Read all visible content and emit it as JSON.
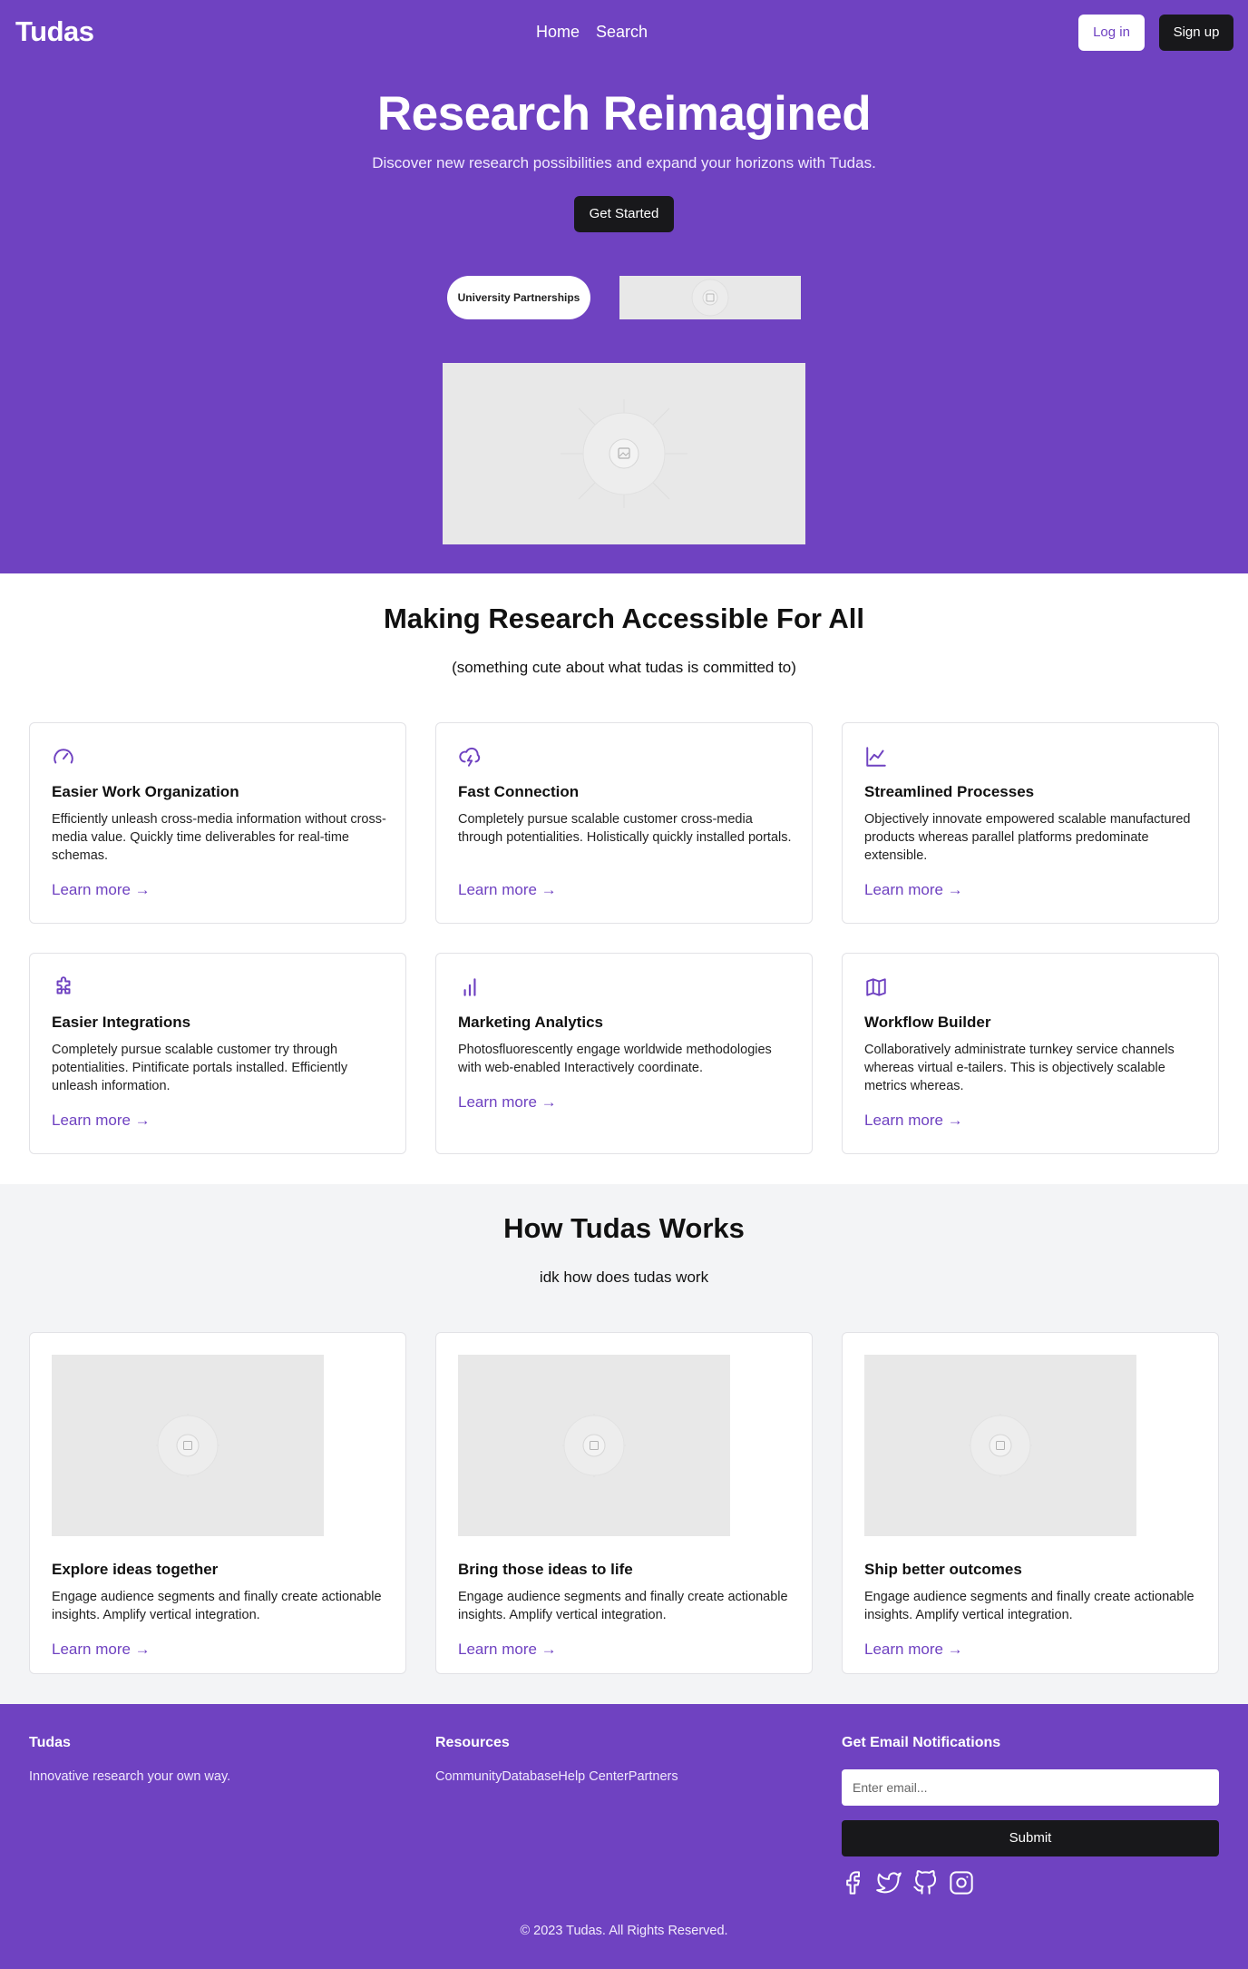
{
  "nav": {
    "brand": "Tudas",
    "links": [
      "Home",
      "Search"
    ],
    "login_label": "Log in",
    "signup_label": "Sign up"
  },
  "hero": {
    "title": "Research Reimagined",
    "subtitle": "Discover new research possibilities and expand your horizons with Tudas.",
    "cta_label": "Get Started",
    "pill_label": "University Partnerships"
  },
  "features": {
    "title": "Making Research Accessible For All",
    "subtitle": "(something cute about what tudas is committed to)",
    "items": [
      {
        "icon": "gauge-icon",
        "title": "Easier Work Organization",
        "text": "Efficiently unleash cross-media information without cross-media value. Quickly time deliverables for real-time schemas.",
        "link": "Learn more →"
      },
      {
        "icon": "cloud-lightning-icon",
        "title": "Fast Connection",
        "text": "Completely pursue scalable customer cross-media through potentialities. Holistically quickly installed portals.",
        "link": "Learn more →"
      },
      {
        "icon": "line-chart-icon",
        "title": "Streamlined Processes",
        "text": "Objectively innovate empowered scalable manufactured products whereas parallel platforms predominate extensible.",
        "link": "Learn more →"
      },
      {
        "icon": "puzzle-icon",
        "title": "Easier Integrations",
        "text": "Completely pursue scalable customer try through potentialities. Pintificate portals installed. Efficiently unleash information.",
        "link": "Learn more →"
      },
      {
        "icon": "bar-chart-icon",
        "title": "Marketing Analytics",
        "text": "Photosfluorescently engage worldwide methodologies with web-enabled Interactively coordinate.",
        "link": "Learn more →"
      },
      {
        "icon": "map-icon",
        "title": "Workflow Builder",
        "text": "Collaboratively administrate turnkey service channels whereas virtual e-tailers. This is objectively scalable metrics whereas.",
        "link": "Learn more →"
      }
    ]
  },
  "how": {
    "title": "How Tudas Works",
    "subtitle": "idk how does tudas work",
    "items": [
      {
        "title": "Explore ideas together",
        "text": "Engage audience segments and finally create actionable insights. Amplify vertical integration.",
        "link": "Learn more →"
      },
      {
        "title": "Bring those ideas to life",
        "text": "Engage audience segments and finally create actionable insights. Amplify vertical integration.",
        "link": "Learn more →"
      },
      {
        "title": "Ship better outcomes",
        "text": "Engage audience segments and finally create actionable insights. Amplify vertical integration.",
        "link": "Learn more →"
      }
    ]
  },
  "footer": {
    "brand": "Tudas",
    "tagline": "Innovative research your own way.",
    "resources_title": "Resources",
    "resources": [
      "Community",
      "Database",
      "Help Center",
      "Partners"
    ],
    "notify_title": "Get Email Notifications",
    "email_placeholder": "Enter email...",
    "submit_label": "Submit",
    "social_icons": [
      "facebook-icon",
      "twitter-icon",
      "github-icon",
      "instagram-icon"
    ],
    "copyright": "© 2023 Tudas. All Rights Reserved."
  },
  "colors": {
    "brand_purple": "#6f42c1",
    "dark_button": "#18181b",
    "section_gray": "#f3f4f6",
    "placeholder_gray": "#e8e8e8"
  }
}
